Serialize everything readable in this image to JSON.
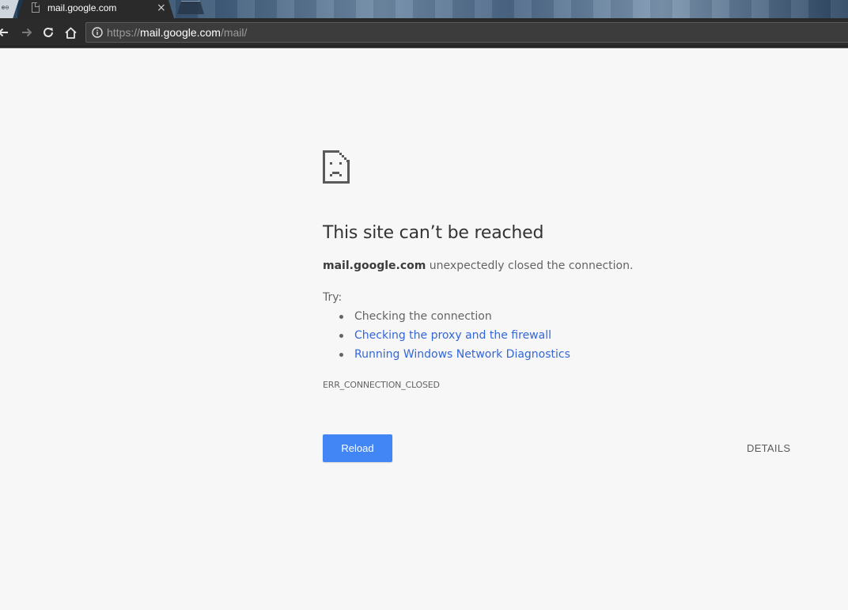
{
  "browser": {
    "tab": {
      "title": "mail.google.com",
      "favicon": "page-icon",
      "close_glyph": "×"
    },
    "left_stub_label": "⊕⊖",
    "toolbar": {
      "back_icon": "back-arrow-icon",
      "forward_icon": "forward-arrow-icon",
      "reload_icon": "reload-icon",
      "home_icon": "home-icon"
    },
    "omnibox": {
      "info_icon": "info-icon",
      "url_scheme": "https://",
      "url_host": "mail.google.com",
      "url_path": "/mail/"
    }
  },
  "error_page": {
    "icon": "sad-page-icon",
    "headline": "This site can’t be reached",
    "summary_host": "mail.google.com",
    "summary_rest": " unexpectedly closed the connection.",
    "try_label": "Try:",
    "suggestions": [
      {
        "text": "Checking the connection",
        "link": false
      },
      {
        "text": "Checking the proxy and the firewall",
        "link": true
      },
      {
        "text": "Running Windows Network Diagnostics",
        "link": true
      }
    ],
    "error_code": "ERR_CONNECTION_CLOSED",
    "reload_label": "Reload",
    "details_label": "DETAILS"
  },
  "colors": {
    "page_background": "#f7f7f7",
    "primary_button": "#4285f4",
    "link": "#3367d6",
    "body_text": "#646464",
    "headline_text": "#333333",
    "toolbar": "#2b2b2b"
  }
}
